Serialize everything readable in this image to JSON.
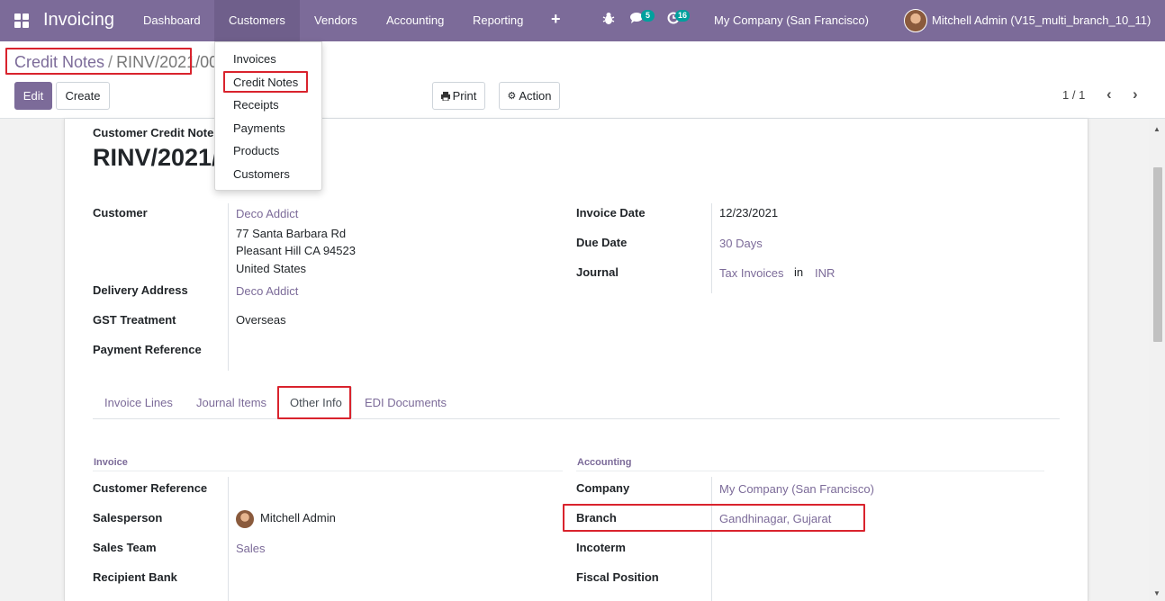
{
  "navbar": {
    "app_name": "Invoicing",
    "menu": [
      "Dashboard",
      "Customers",
      "Vendors",
      "Accounting",
      "Reporting"
    ],
    "plus_icon": "+",
    "messages_count": "5",
    "activities_count": "16",
    "company": "My Company (San Francisco)",
    "user": "Mitchell Admin (V15_multi_branch_10_11)"
  },
  "breadcrumb": {
    "parent": "Credit Notes",
    "separator": "/",
    "current": "RINV/2021/00"
  },
  "buttons": {
    "edit": "Edit",
    "create": "Create",
    "print": "Print",
    "action": "Action"
  },
  "pager": {
    "value": "1 / 1"
  },
  "dropdown": {
    "items": [
      "Invoices",
      "Credit Notes",
      "Receipts",
      "Payments",
      "Products",
      "Customers"
    ]
  },
  "record": {
    "type_label": "Customer Credit Note",
    "name": "RINV/2021/",
    "customer_label": "Customer",
    "customer": "Deco Addict",
    "address_line1": "77 Santa Barbara Rd",
    "address_line2": "Pleasant Hill CA 94523",
    "address_line3": "United States",
    "delivery_label": "Delivery Address",
    "delivery": "Deco Addict",
    "gst_label": "GST Treatment",
    "gst": "Overseas",
    "payment_ref_label": "Payment Reference",
    "invoice_date_label": "Invoice Date",
    "invoice_date": "12/23/2021",
    "due_date_label": "Due Date",
    "due_date": "30 Days",
    "journal_label": "Journal",
    "journal": "Tax Invoices",
    "journal_in": "in",
    "currency": "INR"
  },
  "tabs": [
    "Invoice Lines",
    "Journal Items",
    "Other Info",
    "EDI Documents"
  ],
  "other_info": {
    "invoice_section": "Invoice",
    "customer_ref_label": "Customer Reference",
    "salesperson_label": "Salesperson",
    "salesperson": "Mitchell Admin",
    "sales_team_label": "Sales Team",
    "sales_team": "Sales",
    "recipient_bank_label": "Recipient Bank",
    "accounting_section": "Accounting",
    "company_label": "Company",
    "company": "My Company (San Francisco)",
    "branch_label": "Branch",
    "branch": "Gandhinagar, Gujarat",
    "incoterm_label": "Incoterm",
    "fiscal_position_label": "Fiscal Position"
  },
  "colors": {
    "brand": "#7c6b99",
    "highlight": "#d9232d",
    "badge": "#00a09d"
  }
}
